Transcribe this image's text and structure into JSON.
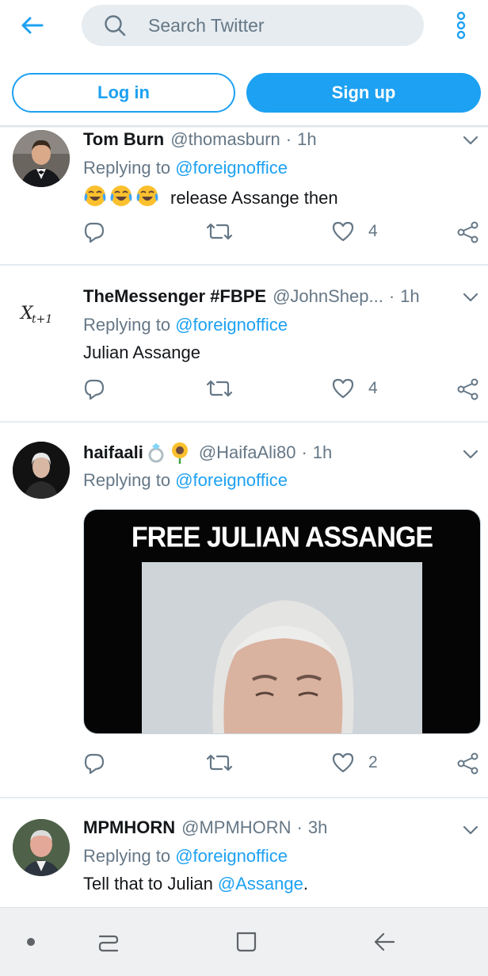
{
  "search": {
    "placeholder": "Search Twitter"
  },
  "auth": {
    "login_label": "Log in",
    "signup_label": "Sign up"
  },
  "colors": {
    "accent": "#1da1f2",
    "secondary_text": "#657786",
    "primary_text": "#14171a",
    "search_bg": "#e6ecf0"
  },
  "tweets": [
    {
      "name": "Tom Burn",
      "handle": "@thomasburn",
      "time": "1h",
      "replying_prefix": "Replying to",
      "replying_to": "@foreignoffice",
      "emojis": [
        "face-with-tears-of-joy",
        "face-with-tears-of-joy",
        "face-with-tears-of-joy"
      ],
      "text": "release Assange then",
      "likes": "4"
    },
    {
      "name": "TheMessenger #FBPE",
      "handle": "@JohnShep...",
      "time": "1h",
      "avatar_text": "X",
      "avatar_sub": "t+1",
      "replying_prefix": "Replying to",
      "replying_to": "@foreignoffice",
      "text": "Julian Assange",
      "likes": "4"
    },
    {
      "name": "haifaali",
      "name_emojis": [
        "ring",
        "sunflower"
      ],
      "handle": "@HaifaAli80",
      "time": "1h",
      "replying_prefix": "Replying to",
      "replying_to": "@foreignoffice",
      "media_text": "FREE JULIAN ASSANGE",
      "likes": "2"
    },
    {
      "name": "MPMHORN",
      "handle": "@MPMHORN",
      "time": "3h",
      "replying_prefix": "Replying to",
      "replying_to": "@foreignoffice",
      "text_prefix": "Tell that to Julian",
      "text_mention": "@Assange",
      "text_suffix": "."
    }
  ],
  "separator": "·",
  "icons": {
    "back": "arrow-left-icon",
    "search": "search-icon",
    "more": "more-vertical-icon",
    "reply": "reply-icon",
    "retweet": "retweet-icon",
    "like": "heart-icon",
    "share": "share-icon",
    "caret": "chevron-down-icon"
  }
}
